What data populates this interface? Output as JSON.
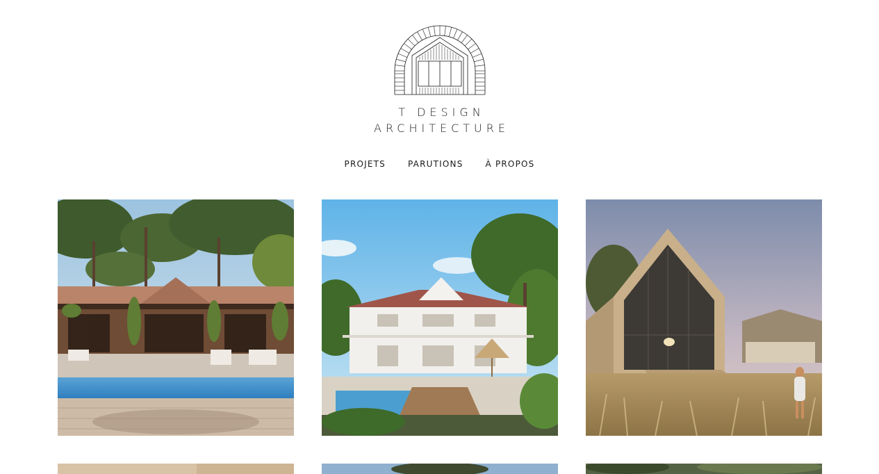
{
  "brand": {
    "line1": "T DESIGN",
    "line2": "ARCHITECTURE",
    "logo_icon": "arched-house-logo-icon"
  },
  "nav": {
    "items": [
      {
        "label": "PROJETS"
      },
      {
        "label": "PARUTIONS"
      },
      {
        "label": "À PROPOS"
      }
    ]
  },
  "projects": [
    {
      "image": "villa-with-pool-render"
    },
    {
      "image": "white-basque-villa-render"
    },
    {
      "image": "gabled-wood-cabin-render"
    },
    {
      "image": "project-thumbnail"
    },
    {
      "image": "project-thumbnail"
    },
    {
      "image": "project-thumbnail"
    }
  ],
  "colors": {
    "text": "#1a1a1a",
    "background": "#ffffff"
  }
}
